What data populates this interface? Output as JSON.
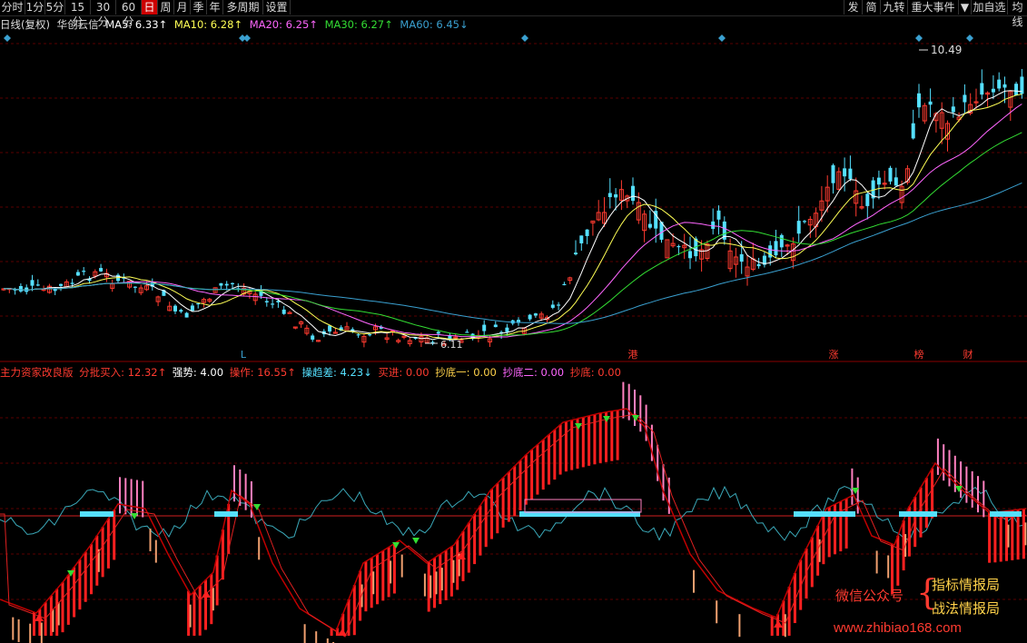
{
  "toolbar": {
    "left": [
      "分时",
      "1分",
      "5分",
      "15分",
      "30分",
      "60分",
      "日",
      "周",
      "月",
      "季",
      "年",
      "多周期",
      "设置"
    ],
    "active": "日",
    "right": [
      "发",
      "简",
      "九转",
      "重大事件",
      "▼",
      "加自选",
      "均线"
    ]
  },
  "main_legend": {
    "prefix": "日线(复权)",
    "stock": "华创云信",
    "ma5": "MA5: 6.33↑",
    "ma10": "MA10: 6.28↑",
    "ma20": "MA20: 6.25↑",
    "ma30": "MA30: 6.27↑",
    "ma60": "MA60: 6.45↓"
  },
  "sub_legend": {
    "name": "主力资家改良版",
    "pibuy": "分批买入: 12.32↑",
    "qiangshi": "强势: 4.00",
    "caozuo": "操作: 16.55↑",
    "caoqu": "操趋差: 4.23↓",
    "maijin": "买进: 0.00",
    "chaodi1": "抄底一: 0.00",
    "chaodi2": "抄底二: 0.00",
    "chaodi": "抄底: 0.00"
  },
  "colors": {
    "up": "#ff3b30",
    "down": "#55e0ff",
    "ma5": "#ffffff",
    "ma10": "#ffff55",
    "ma20": "#ff66ff",
    "ma30": "#33dd33",
    "ma60": "#3aa0d0",
    "grid": "#5a0000"
  },
  "chart_data": [
    {
      "type": "candlestick",
      "title": "华创云信 日线(复权)",
      "series": [
        {
          "name": "MA5",
          "value": 6.33
        },
        {
          "name": "MA10",
          "value": 6.28
        },
        {
          "name": "MA20",
          "value": 6.25
        },
        {
          "name": "MA30",
          "value": 6.27
        },
        {
          "name": "MA60",
          "value": 6.45
        }
      ],
      "annotations": [
        {
          "label": "10.49",
          "kind": "high"
        },
        {
          "label": "6.11",
          "kind": "low"
        }
      ],
      "event_markers": [
        "L",
        "港",
        "涨",
        "榜",
        "财"
      ],
      "grid": true
    },
    {
      "type": "bar",
      "title": "主力资家改良版",
      "series": [
        {
          "name": "分批买入",
          "value": 12.32
        },
        {
          "name": "强势",
          "value": 4.0
        },
        {
          "name": "操作",
          "value": 16.55
        },
        {
          "name": "操趋差",
          "value": 4.23
        },
        {
          "name": "买进",
          "value": 0.0
        },
        {
          "name": "抄底一",
          "value": 0.0
        },
        {
          "name": "抄底二",
          "value": 0.0
        },
        {
          "name": "抄底",
          "value": 0.0
        }
      ],
      "grid": true
    }
  ],
  "watermark": {
    "left": "微信公众号",
    "r1": "指标情报局",
    "r2": "战法情报局",
    "url": "www.zhibiao168.com"
  }
}
